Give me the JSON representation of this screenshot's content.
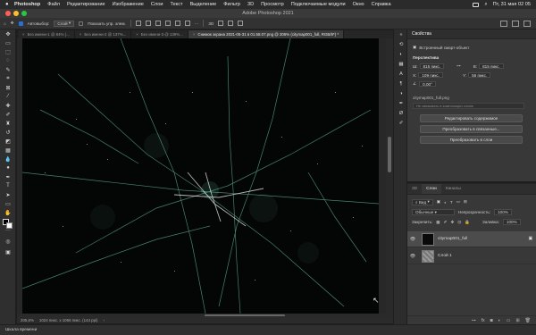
{
  "menubar": {
    "app_name": "Photoshop",
    "items": [
      "Файл",
      "Редактирование",
      "Изображение",
      "Слои",
      "Текст",
      "Выделение",
      "Фильтр",
      "3D",
      "Просмотр",
      "Подключаемые модули",
      "Окно",
      "Справка"
    ],
    "clock": "Пт, 31 мая 02 05"
  },
  "window": {
    "title": "Adobe Photoshop 2021"
  },
  "options_bar": {
    "autoselect_label": "Автовыбор:",
    "autoselect_target": "Слой",
    "show_transform_label": "Показать упр. элем."
  },
  "doc_tabs": [
    {
      "label": "Без имени-1 @ 84% (..."
    },
    {
      "label": "Без имени-2 @ 137%..."
    },
    {
      "label": "Без имени-3 @ 139%..."
    },
    {
      "label": "Снимок экрана 2021-05-31 в 01.58.07.png @ 206% (citymap001_full, RGB/8*) *"
    }
  ],
  "status": {
    "zoom": "205,6%",
    "size": "1024 пикс. x 1066 пикс. (144 ppi)"
  },
  "timeline": {
    "label": "Шкала времени"
  },
  "properties": {
    "title": "Свойства",
    "object_type": "Встроенный смарт-объект",
    "transform_section": "Перспектива",
    "w_label": "Ш:",
    "w_value": "815 пикс.",
    "h_label": "В:",
    "h_value": "815 пикс.",
    "x_label": "X:",
    "x_value": "109 пикс.",
    "y_label": "Y:",
    "y_value": "56 пикс.",
    "angle_value": "0,00°",
    "filename": "citymap001_full.png",
    "hint": "Не связывать в композиции слоев",
    "buttons": [
      "Редактировать содержимое",
      "Преобразовать в связанные...",
      "Преобразовать в слои"
    ]
  },
  "layers_panel": {
    "tabs": [
      "3D",
      "Слои",
      "Каналы"
    ],
    "active_tab": "Слои",
    "kind_filter": "Вид",
    "blend_mode": "Обычные",
    "opacity_label": "Непрозрачность:",
    "opacity_value": "100%",
    "lock_label": "Закрепить:",
    "fill_label": "Заливка:",
    "fill_value": "100%",
    "layers": [
      {
        "name": "citymap001_full",
        "visible": true,
        "selected": true
      },
      {
        "name": "Слой 1",
        "visible": true,
        "selected": false
      }
    ]
  },
  "colors": {
    "accent": "#2a6edb",
    "canvas": "#040505",
    "road_glow": "#7de8c8"
  }
}
